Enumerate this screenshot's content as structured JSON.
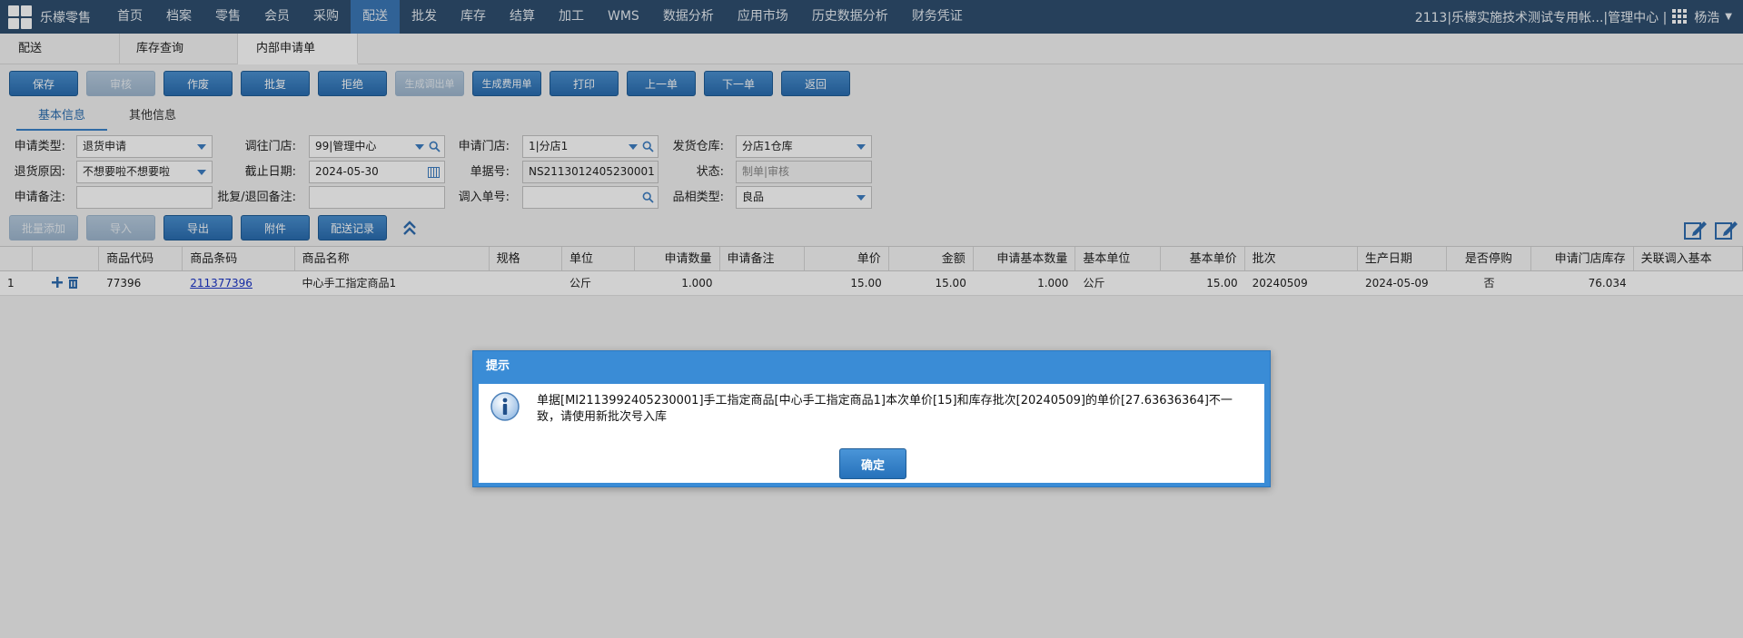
{
  "topbar": {
    "brand": "乐檬零售",
    "nav": [
      "首页",
      "档案",
      "零售",
      "会员",
      "采购",
      "配送",
      "批发",
      "库存",
      "结算",
      "加工",
      "WMS",
      "数据分析",
      "应用市场",
      "历史数据分析",
      "财务凭证"
    ],
    "active_nav": "配送",
    "account": "2113|乐檬实施技术测试专用帐...|管理中心 |",
    "user": "杨浩"
  },
  "page_tabs": [
    {
      "label": "配送"
    },
    {
      "label": "库存查询"
    },
    {
      "label": "内部申请单",
      "close": "×"
    }
  ],
  "toolbar": {
    "save": "保存",
    "audit": "审核",
    "void": "作废",
    "approve": "批复",
    "reject": "拒绝",
    "gen_transfer": "生成调出单",
    "gen_fee": "生成费用单",
    "print": "打印",
    "prev": "上一单",
    "next": "下一单",
    "back": "返回"
  },
  "sub_tabs": {
    "basic": "基本信息",
    "other": "其他信息"
  },
  "form": {
    "apply_type_label": "申请类型:",
    "apply_type": "退货申请",
    "to_store_label": "调往门店:",
    "to_store": "99|管理中心",
    "apply_store_label": "申请门店:",
    "apply_store": "1|分店1",
    "ship_wh_label": "发货仓库:",
    "ship_wh": "分店1仓库",
    "return_reason_label": "退货原因:",
    "return_reason": "不想要啦不想要啦",
    "deadline_label": "截止日期:",
    "deadline": "2024-05-30",
    "doc_no_label": "单据号:",
    "doc_no": "NS2113012405230001",
    "status_label": "状态:",
    "status_placeholder": "制单|审核",
    "remark_label": "申请备注:",
    "remark": "",
    "reply_remark_label": "批复/退回备注:",
    "reply_remark": "",
    "in_doc_label": "调入单号:",
    "in_doc": "",
    "category_label": "品相类型:",
    "category": "良品"
  },
  "toolbar2": {
    "batch_add": "批量添加",
    "import": "导入",
    "export": "导出",
    "attach": "附件",
    "dist_log": "配送记录"
  },
  "grid": {
    "headers": [
      "",
      "",
      "商品代码",
      "商品条码",
      "商品名称",
      "规格",
      "单位",
      "申请数量",
      "申请备注",
      "单价",
      "金额",
      "申请基本数量",
      "基本单位",
      "基本单价",
      "批次",
      "生产日期",
      "是否停购",
      "申请门店库存",
      "关联调入基本"
    ],
    "rows": [
      {
        "no": "1",
        "code": "77396",
        "barcode": "211377396",
        "name": "中心手工指定商品1",
        "spec": "",
        "unit": "公斤",
        "qty": "1.000",
        "remark": "",
        "price": "15.00",
        "amount": "15.00",
        "base_qty": "1.000",
        "base_unit": "公斤",
        "base_price": "15.00",
        "batch": "20240509",
        "prod_date": "2024-05-09",
        "stopped": "否",
        "store_stock": "76.034",
        "linked": ""
      }
    ]
  },
  "dialog": {
    "title": "提示",
    "message": "单据[MI2113992405230001]手工指定商品[中心手工指定商品1]本次单价[15]和库存批次[20240509]的单价[27.63636364]不一致，请使用新批次号入库",
    "ok": "确定"
  }
}
